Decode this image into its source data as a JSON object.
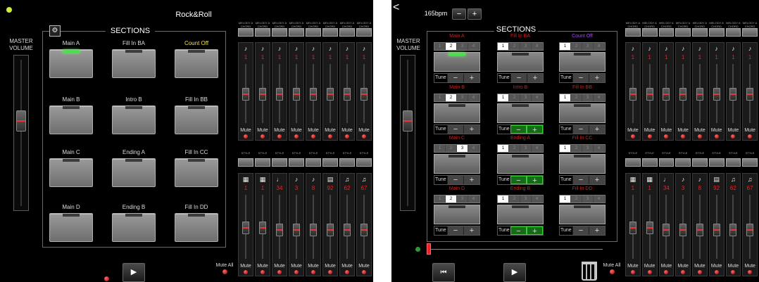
{
  "screen1": {
    "title": "Rock&Roll",
    "sections_title": "SECTIONS",
    "settings_icon": "gear-icon",
    "master_volume_label": "MASTER\nVOLUME",
    "master_volume_level": 0.6,
    "pads": [
      [
        "Main A",
        "Fill In BA",
        "Count Off"
      ],
      [
        "Main B",
        "Intro B",
        "Fill In BB"
      ],
      [
        "Main C",
        "Ending A",
        "Fill In CC"
      ],
      [
        "Main D",
        "Ending B",
        "Fill In DD"
      ]
    ],
    "count_off_color": "#f2e24a",
    "active_pad": "Main A",
    "top_buttons": [
      "MELODY A CHORD",
      "MELODY A CHORD",
      "MELODY A CHORD",
      "MELODY A CHORD",
      "MELODY A CHORD",
      "MELODY A CHORD",
      "MELODY A CHORD",
      "MELODY A CHORD"
    ],
    "top_mixer": {
      "icons": [
        "♪",
        "♪",
        "♪",
        "♪",
        "♪",
        "♪",
        "♪",
        "♪"
      ],
      "values": [
        "1",
        "1",
        "1",
        "1",
        "1",
        "1",
        "1",
        "1"
      ],
      "levels": [
        0.5,
        0.5,
        0.5,
        0.5,
        0.5,
        0.5,
        0.5,
        0.5
      ]
    },
    "style_buttons": [
      "STYLE",
      "STYLE",
      "STYLE",
      "STYLE",
      "STYLE",
      "STYLE",
      "STYLE",
      "STYLE"
    ],
    "bottom_mixer": {
      "icons": [
        "▦",
        "▦",
        "♩",
        "♪",
        "♪",
        "▤",
        "♫",
        "♫"
      ],
      "values": [
        "1",
        "1",
        "34",
        "3",
        "8",
        "92",
        "62",
        "67"
      ],
      "levels": [
        0.5,
        0.5,
        0.45,
        0.45,
        0.45,
        0.45,
        0.45,
        0.45
      ]
    },
    "mute_label": "Mute",
    "mute_all_label": "Mute All",
    "play_icon": "play-icon"
  },
  "screen2": {
    "back_icon": "chevron-left-icon",
    "bpm": "165bpm",
    "bpm_minus": "−",
    "bpm_plus": "+",
    "sections_title": "SECTIONS",
    "master_volume_label": "MASTER\nVOLUME",
    "master_volume_level": 0.6,
    "cells": [
      [
        {
          "name": "Main A",
          "seg": 1,
          "green": false,
          "on": true,
          "purple": false
        },
        {
          "name": "Fill In BA",
          "seg": 0,
          "green": false,
          "on": false,
          "purple": false
        },
        {
          "name": "Count Off",
          "seg": 0,
          "green": false,
          "on": false,
          "purple": true
        }
      ],
      [
        {
          "name": "Main B",
          "seg": 1,
          "green": false,
          "on": false,
          "purple": false
        },
        {
          "name": "Intro B",
          "seg": 0,
          "green": true,
          "on": false,
          "purple": false
        },
        {
          "name": "Fill In BB",
          "seg": 0,
          "green": false,
          "on": false,
          "purple": false
        }
      ],
      [
        {
          "name": "Main C",
          "seg": 2,
          "green": false,
          "on": false,
          "purple": false
        },
        {
          "name": "Ending A",
          "seg": 0,
          "green": true,
          "on": false,
          "purple": false
        },
        {
          "name": "Fill In CC",
          "seg": 0,
          "green": false,
          "on": false,
          "purple": false
        }
      ],
      [
        {
          "name": "Main D",
          "seg": 1,
          "green": false,
          "on": false,
          "purple": false
        },
        {
          "name": "Ending B",
          "seg": 0,
          "green": true,
          "on": false,
          "purple": false
        },
        {
          "name": "Fill In DD",
          "seg": 0,
          "green": false,
          "on": false,
          "purple": false
        }
      ]
    ],
    "segment_labels": [
      "1",
      "2",
      "3",
      "4"
    ],
    "tune_label": "Tune",
    "tune_minus": "−",
    "tune_plus": "+",
    "top_buttons": [
      "MELODY A CHORD",
      "MELODY A CHORD",
      "MELODY A CHORD",
      "MELODY A CHORD",
      "MELODY A CHORD",
      "MELODY A CHORD",
      "MELODY A CHORD",
      "MELODY A CHORD"
    ],
    "top_mixer": {
      "icons": [
        "♪",
        "♪",
        "♪",
        "♪",
        "♪",
        "♪",
        "♪",
        "♪"
      ],
      "values": [
        "1",
        "1",
        "1",
        "1",
        "1",
        "1",
        "1",
        "1"
      ],
      "levels": [
        0.5,
        0.5,
        0.5,
        0.5,
        0.5,
        0.5,
        0.5,
        0.5
      ]
    },
    "style_buttons": [
      "STYLE",
      "STYLE",
      "STYLE",
      "STYLE",
      "STYLE",
      "STYLE",
      "STYLE",
      "STYLE"
    ],
    "bottom_mixer": {
      "icons": [
        "▦",
        "▦",
        "♩",
        "♪",
        "♪",
        "▤",
        "♫",
        "♫"
      ],
      "values": [
        "1",
        "1",
        "34",
        "3",
        "8",
        "92",
        "62",
        "67"
      ],
      "levels": [
        0.5,
        0.5,
        0.45,
        0.45,
        0.45,
        0.45,
        0.45,
        0.45
      ]
    },
    "mute_label": "Mute",
    "mute_all_label": "Mute All",
    "progress": 0.0,
    "rewind_icon": "skip-back-icon",
    "play_icon": "play-icon",
    "trash_icon": "trash-icon"
  },
  "colors": {
    "accent_red": "#cc2222",
    "green": "#4be04b",
    "purple": "#b040ff"
  }
}
